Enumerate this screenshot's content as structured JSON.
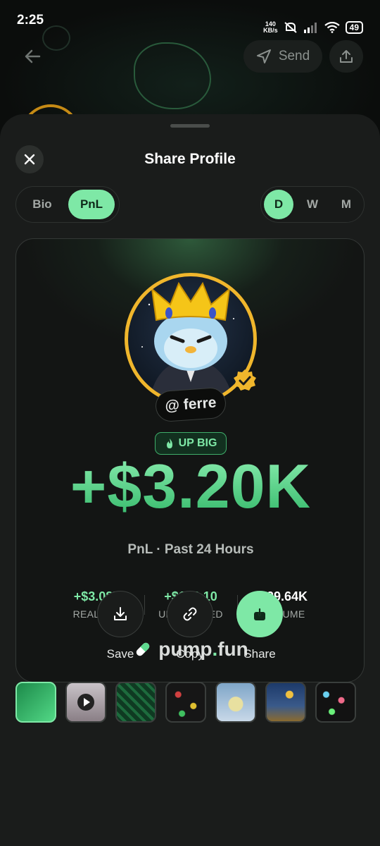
{
  "status_bar": {
    "time": "2:25",
    "net_speed_value": "140",
    "net_speed_unit": "KB/s",
    "battery": "49"
  },
  "top_nav": {
    "send_label": "Send"
  },
  "sheet": {
    "title": "Share Profile",
    "view_tabs": [
      {
        "label": "Bio",
        "active": false
      },
      {
        "label": "PnL",
        "active": true
      }
    ],
    "period_tabs": [
      {
        "label": "D",
        "active": true
      },
      {
        "label": "W",
        "active": false
      },
      {
        "label": "M",
        "active": false
      }
    ]
  },
  "card": {
    "handle": "@ ferre",
    "badge": "UP BIG",
    "pnl_value": "+$3.20K",
    "period_label": "PnL · Past 24 Hours",
    "stats": [
      {
        "value": "+$3.08K",
        "label": "REALIZED",
        "color": "#7ee8a6"
      },
      {
        "value": "+$122.10",
        "label": "UNREALIZED",
        "color": "#7ee8a6"
      },
      {
        "value": "$29.64K",
        "label": "VOLUME",
        "color": "#ffffff"
      }
    ],
    "brand_name": "pump",
    "brand_dot": ".",
    "brand_suffix": "fun"
  },
  "actions": [
    {
      "label": "Save",
      "icon": "download-icon"
    },
    {
      "label": "Copy",
      "icon": "link-icon"
    },
    {
      "label": "Share",
      "icon": "share-icon"
    }
  ],
  "colors": {
    "accent": "#7ee8a6",
    "background": "#1a1c1b",
    "card": "#131514",
    "avatar_ring": "#f0b62c"
  }
}
